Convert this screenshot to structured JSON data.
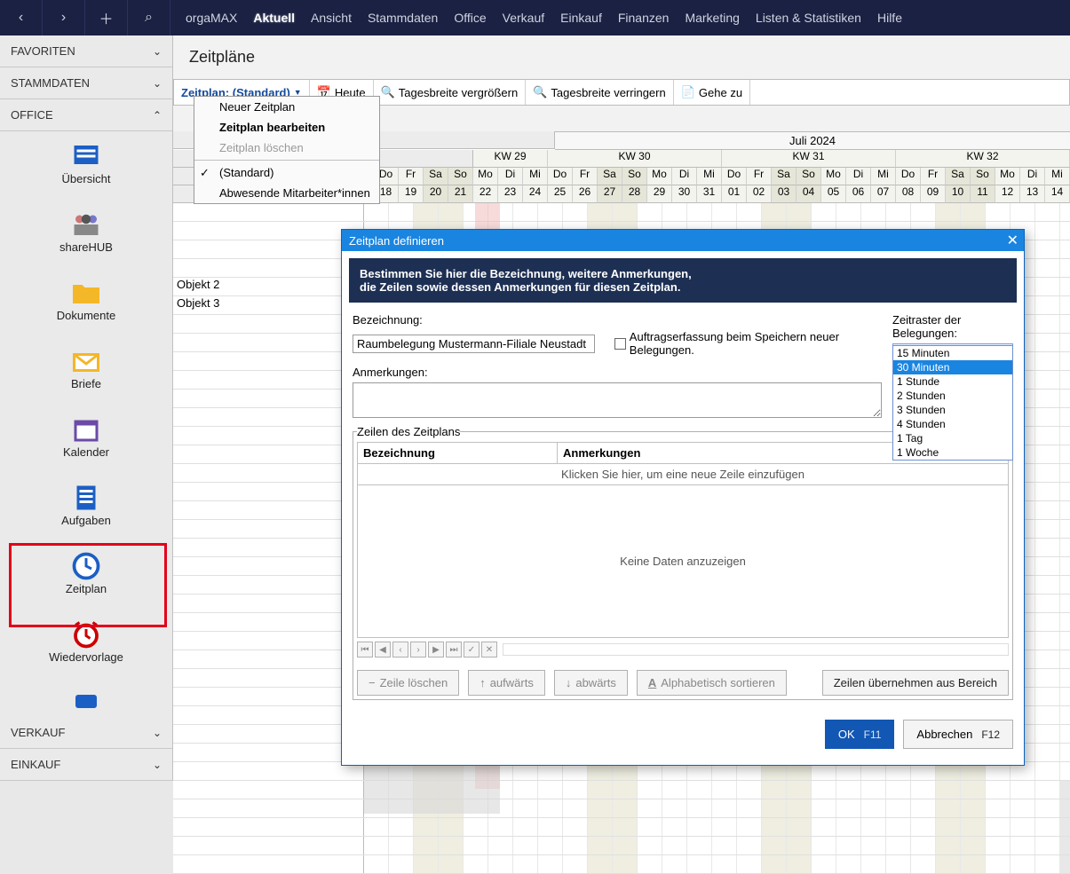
{
  "topbar": {
    "brand": "orgaMAX",
    "menus": [
      "Aktuell",
      "Ansicht",
      "Stammdaten",
      "Office",
      "Verkauf",
      "Einkauf",
      "Finanzen",
      "Marketing",
      "Listen & Statistiken",
      "Hilfe"
    ],
    "active_index": 0
  },
  "sidebar": {
    "sections": {
      "favoriten": "FAVORITEN",
      "stammdaten": "STAMMDATEN",
      "office": "OFFICE",
      "verkauf": "VERKAUF",
      "einkauf": "EINKAUF"
    },
    "office_items": [
      {
        "label": "Übersicht",
        "icon": "list"
      },
      {
        "label": "shareHUB",
        "icon": "people"
      },
      {
        "label": "Dokumente",
        "icon": "folder"
      },
      {
        "label": "Briefe",
        "icon": "envelope"
      },
      {
        "label": "Kalender",
        "icon": "calendar"
      },
      {
        "label": "Aufgaben",
        "icon": "clipboard"
      },
      {
        "label": "Zeitplan",
        "icon": "clock"
      },
      {
        "label": "Wiedervorlage",
        "icon": "alarm"
      }
    ]
  },
  "page": {
    "title": "Zeitpläne"
  },
  "toolbar": {
    "zeitplan": "Zeitplan: (Standard)",
    "heute": "Heute",
    "vergroessern": "Tagesbreite vergrößern",
    "verringern": "Tagesbreite verringern",
    "gehe_zu": "Gehe zu"
  },
  "zeitplan_menu": {
    "neu": "Neuer Zeitplan",
    "bearbeiten": "Zeitplan bearbeiten",
    "loeschen": "Zeitplan löschen",
    "standard": "(Standard)",
    "abwesende": "Abwesende Mitarbeiter*innen"
  },
  "calendar": {
    "month": "Juli 2024",
    "weeks": [
      "KW 29",
      "KW 30",
      "KW 31",
      "KW 32"
    ],
    "days": [
      "Do",
      "Fr",
      "Sa",
      "So",
      "Mo",
      "Di",
      "Mi",
      "Do",
      "Fr",
      "Sa",
      "So",
      "Mo",
      "Di",
      "Mi",
      "Do",
      "Fr",
      "Sa",
      "So",
      "Mo",
      "Di",
      "Mi",
      "Do",
      "Fr",
      "Sa",
      "So",
      "Mo",
      "Di",
      "Mi"
    ],
    "dates": [
      "18",
      "19",
      "20",
      "21",
      "22",
      "23",
      "24",
      "25",
      "26",
      "27",
      "28",
      "29",
      "30",
      "31",
      "01",
      "02",
      "03",
      "04",
      "05",
      "06",
      "07",
      "08",
      "09",
      "10",
      "11",
      "12",
      "13",
      "14"
    ],
    "rows": [
      "Objekt 2",
      "Objekt 3"
    ]
  },
  "dialog": {
    "title": "Zeitplan definieren",
    "info1": "Bestimmen Sie hier die Bezeichnung, weitere Anmerkungen,",
    "info2": "die Zeilen sowie dessen Anmerkungen für diesen Zeitplan.",
    "bezeichnung_label": "Bezeichnung:",
    "bezeichnung_value": "Raumbelegung Mustermann-Filiale Neustadt",
    "auftragserfassung": "Auftragserfassung beim Speichern neuer Belegungen.",
    "zeitraster_label": "Zeitraster der Belegungen:",
    "zeitraster_selected": "15 Minuten",
    "zeitraster_options": [
      "15 Minuten",
      "30 Minuten",
      "1 Stunde",
      "2 Stunden",
      "3 Stunden",
      "4 Stunden",
      "1 Tag",
      "1 Woche"
    ],
    "zeitraster_highlight_index": 1,
    "anmerkungen_label": "Anmerkungen:",
    "zeilen_legend": "Zeilen des Zeitplans",
    "col_bezeichnung": "Bezeichnung",
    "col_anmerkungen": "Anmerkungen",
    "add_row_hint": "Klicken Sie hier, um eine neue Zeile einzufügen",
    "no_data": "Keine Daten anzuzeigen",
    "btn_loeschen": "Zeile löschen",
    "btn_aufwaerts": "aufwärts",
    "btn_abwaerts": "abwärts",
    "btn_sort": "Alphabetisch sortieren",
    "btn_uebernehmen": "Zeilen übernehmen aus Bereich",
    "ok": "OK",
    "ok_hint": "F11",
    "cancel": "Abbrechen",
    "cancel_hint": "F12"
  }
}
